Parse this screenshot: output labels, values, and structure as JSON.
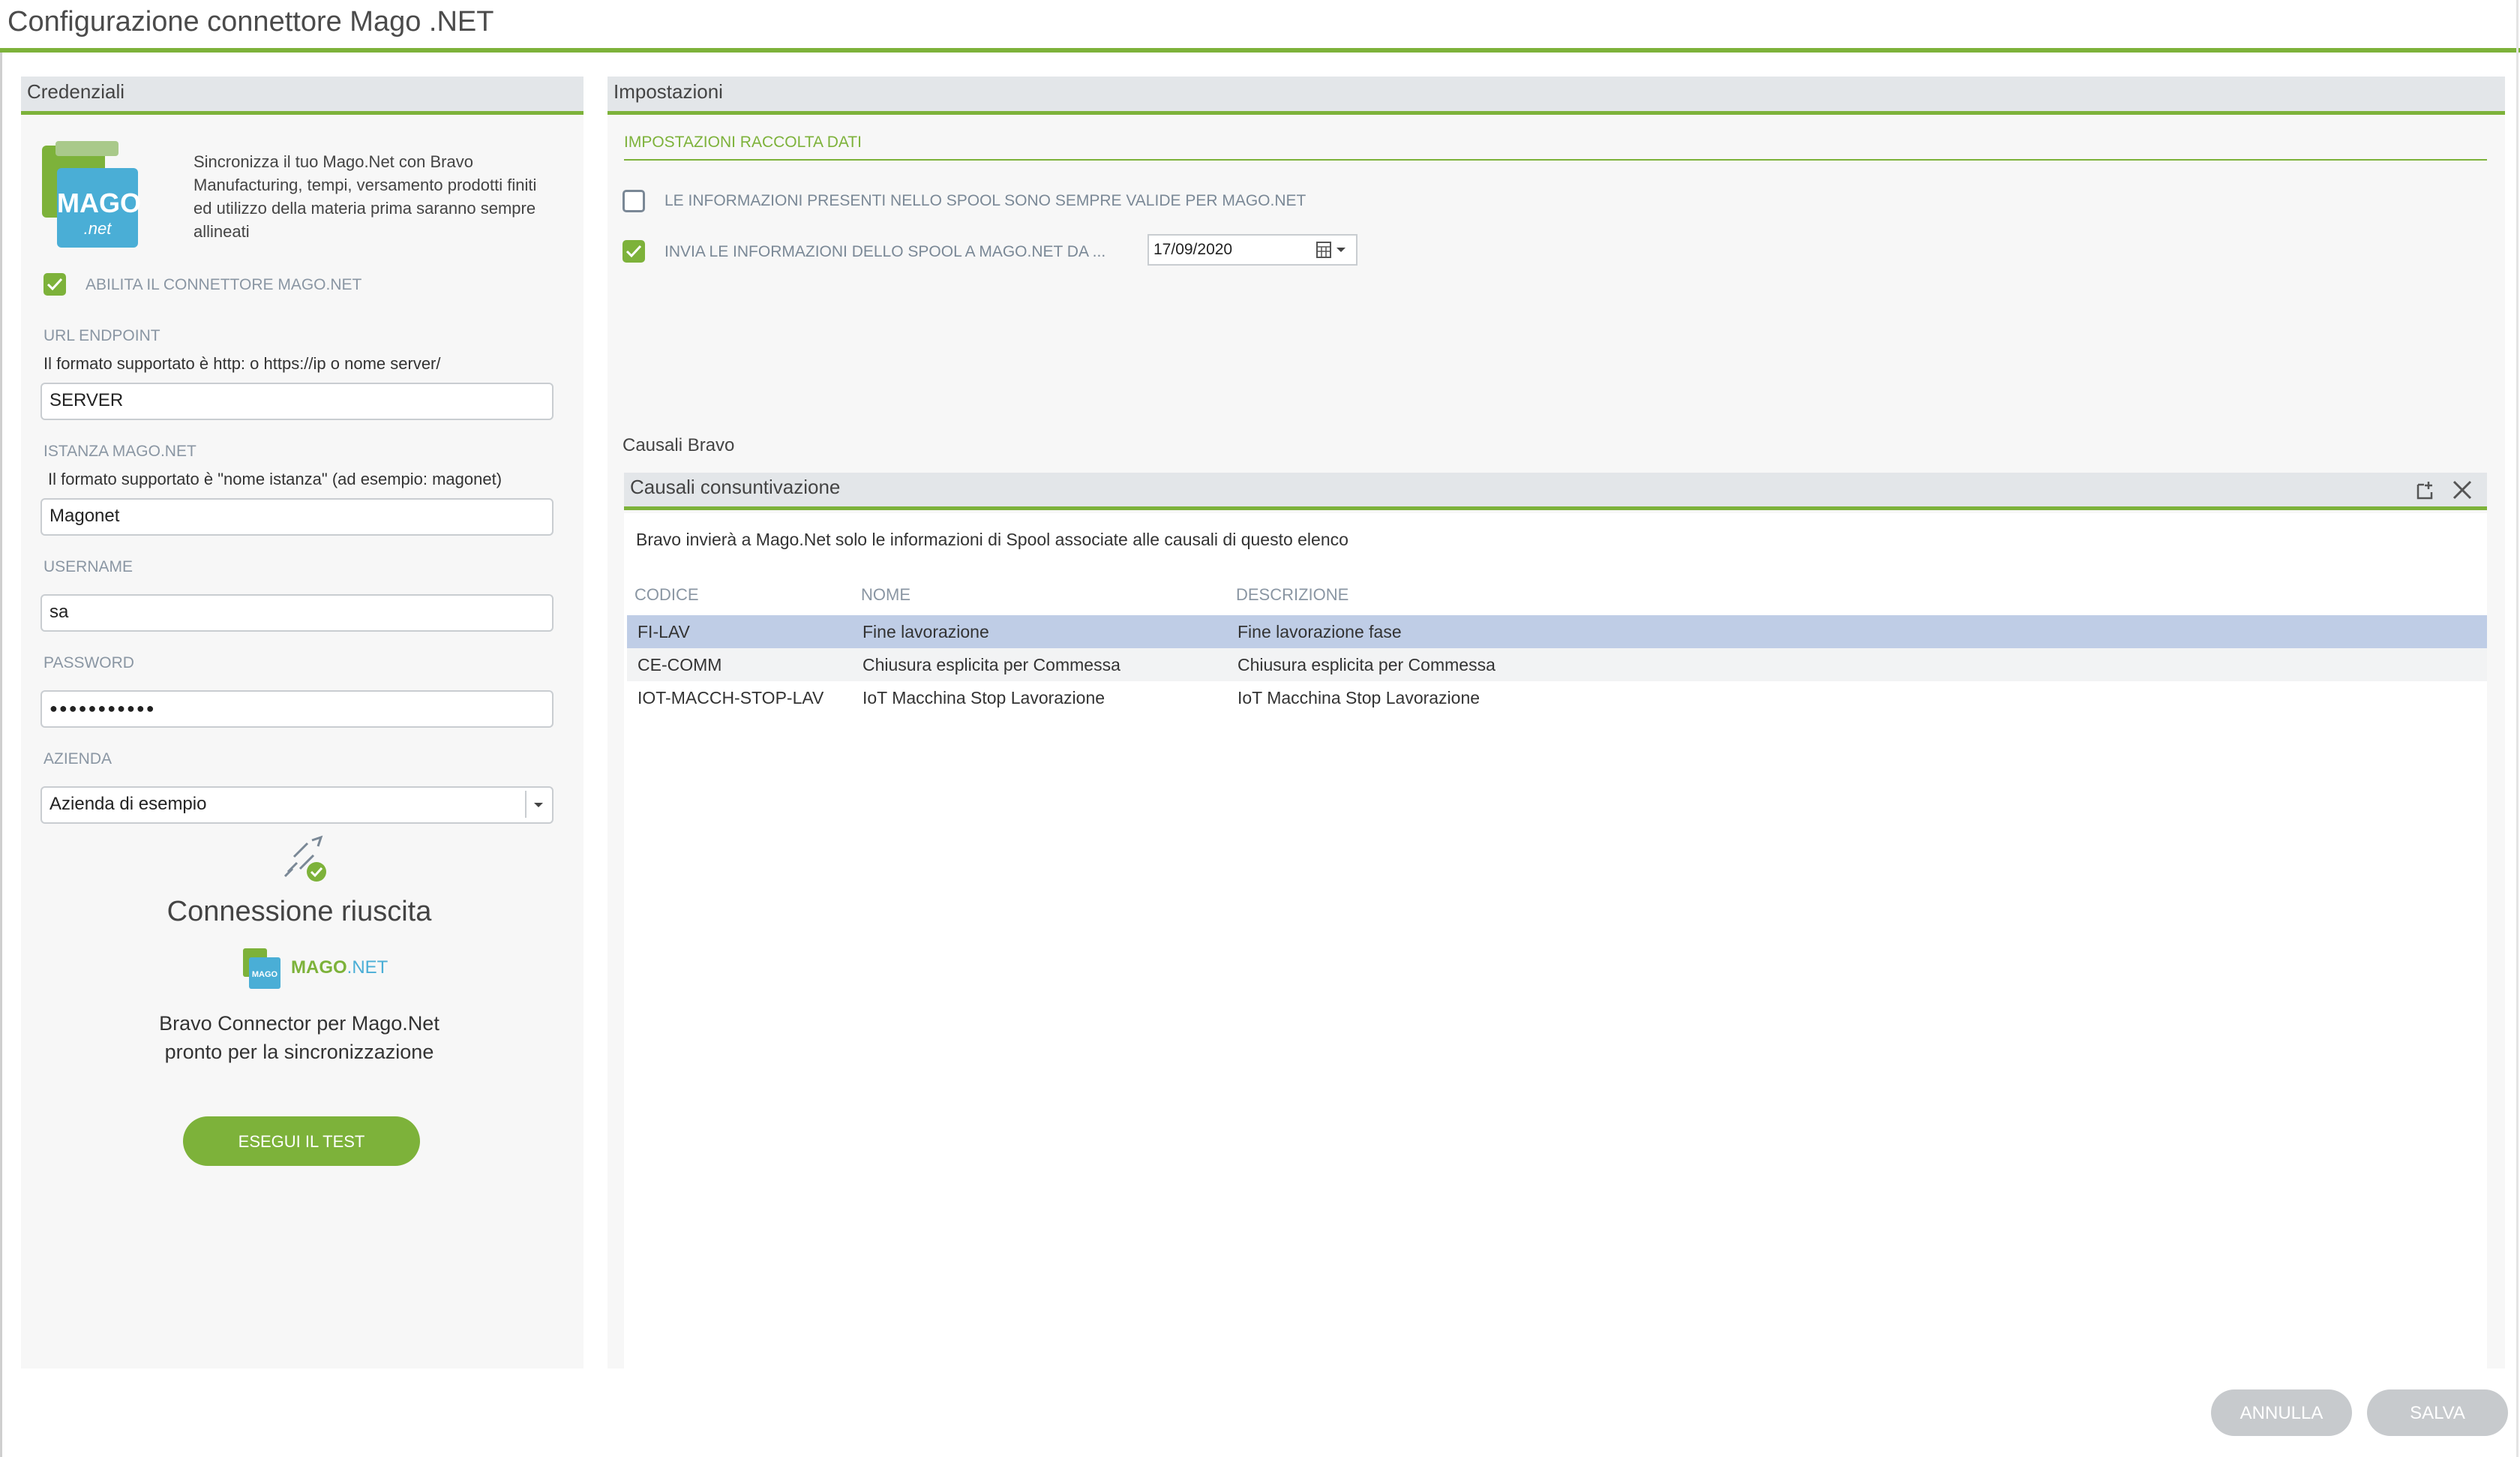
{
  "window": {
    "title": "Configurazione connettore Mago .NET"
  },
  "credentials": {
    "header": "Credenziali",
    "logo_text": "MAGO",
    "logo_sub": ".net",
    "intro": "Sincronizza il tuo Mago.Net con Bravo Manufacturing, tempi, versamento prodotti finiti ed utilizzo della materia prima saranno sempre allineati",
    "enable_label": "ABILITA IL CONNETTORE MAGO.NET",
    "enable_checked": true,
    "url_label": "URL ENDPOINT",
    "url_hint": "Il formato supportato è http: o https://ip o nome server/",
    "url_value": "SERVER",
    "instance_label": "ISTANZA MAGO.NET",
    "instance_hint": "Il formato supportato è \"nome istanza\" (ad esempio: magonet)",
    "instance_value": "Magonet",
    "username_label": "USERNAME",
    "username_value": "sa",
    "password_label": "PASSWORD",
    "password_value": "●●●●●●●●●●●",
    "company_label": "AZIENDA",
    "company_value": "Azienda di esempio",
    "success_title": "Connessione riuscita",
    "mago_small_a": "MAGO",
    "mago_small_b": ".NET",
    "ready_line1": "Bravo Connector per Mago.Net",
    "ready_line2": "pronto per la sincronizzazione",
    "test_button": "ESEGUI IL TEST"
  },
  "settings": {
    "header": "Impostazioni",
    "section": "IMPOSTAZIONI RACCOLTA DATI",
    "option1_label": "LE INFORMAZIONI PRESENTI NELLO SPOOL SONO SEMPRE VALIDE PER MAGO.NET",
    "option1_checked": false,
    "option2_label": "INVIA LE INFORMAZIONI DELLO SPOOL A MAGO.NET DA ...",
    "option2_checked": true,
    "date_value": "17/09/2020"
  },
  "causali": {
    "tab_label": "Causali Bravo",
    "grid_title": "Causali consuntivazione",
    "description": "Bravo invierà a Mago.Net solo le informazioni di Spool associate alle causali di questo elenco",
    "columns": [
      "CODICE",
      "NOME",
      "DESCRIZIONE"
    ],
    "rows": [
      {
        "code": "FI-LAV",
        "name": "Fine lavorazione",
        "description": "Fine lavorazione fase"
      },
      {
        "code": "CE-COMM",
        "name": "Chiusura esplicita per Commessa",
        "description": "Chiusura esplicita per Commessa"
      },
      {
        "code": "IOT-MACCH-STOP-LAV",
        "name": "IoT Macchina Stop Lavorazione",
        "description": "IoT Macchina Stop Lavorazione"
      }
    ]
  },
  "footer": {
    "cancel": "ANNULLA",
    "save": "SALVA"
  },
  "colors": {
    "accent": "#7db23a",
    "selection": "#bfcde6",
    "logo_blue": "#4aaed6",
    "button_disabled": "#c7cacd"
  }
}
